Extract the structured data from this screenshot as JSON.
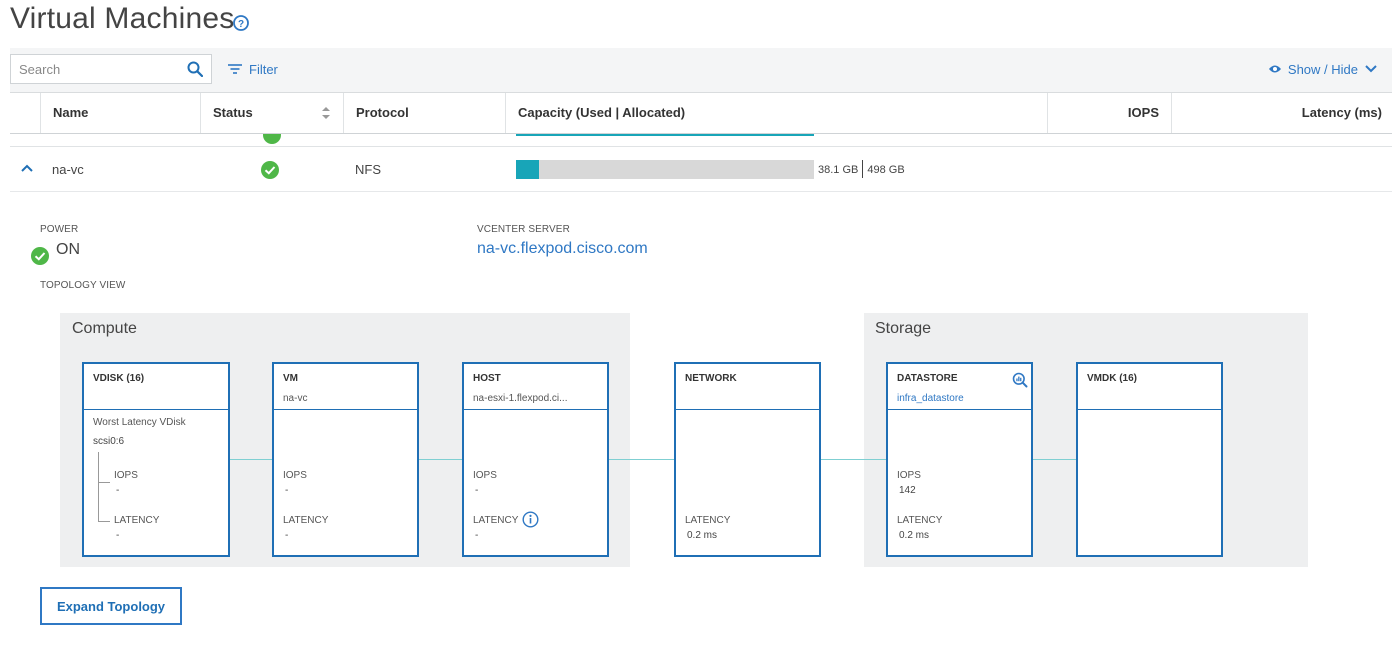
{
  "page": {
    "title": "Virtual Machines"
  },
  "toolbar": {
    "search_placeholder": "Search",
    "filter_label": "Filter",
    "show_hide_label": "Show / Hide"
  },
  "table": {
    "columns": [
      "Name",
      "Status",
      "Protocol",
      "Capacity (Used | Allocated)",
      "IOPS",
      "Latency (ms)"
    ],
    "row": {
      "name": "na-vc",
      "status": "ok",
      "protocol": "NFS",
      "capacity_used": "38.1 GB",
      "capacity_allocated": "498 GB",
      "capacity_fraction": 0.0765
    }
  },
  "details": {
    "power_label": "POWER",
    "power_value": "ON",
    "vcenter_label": "VCENTER SERVER",
    "vcenter_value": "na-vc.flexpod.cisco.com",
    "topology_label": "TOPOLOGY VIEW"
  },
  "topology": {
    "compute_title": "Compute",
    "storage_title": "Storage",
    "vdisk": {
      "title": "VDISK (16)",
      "worst_label": "Worst Latency VDisk",
      "worst_value": "scsi0:6",
      "iops_label": "IOPS",
      "iops_value": "-",
      "latency_label": "LATENCY",
      "latency_value": "-"
    },
    "vm": {
      "title": "VM",
      "subtitle": "na-vc",
      "iops_label": "IOPS",
      "iops_value": "-",
      "latency_label": "LATENCY",
      "latency_value": "-"
    },
    "host": {
      "title": "HOST",
      "subtitle": "na-esxi-1.flexpod.ci...",
      "iops_label": "IOPS",
      "iops_value": "-",
      "latency_label": "LATENCY",
      "latency_value": "-"
    },
    "network": {
      "title": "NETWORK",
      "latency_label": "LATENCY",
      "latency_value": "0.2 ms"
    },
    "datastore": {
      "title": "DATASTORE",
      "subtitle": "infra_datastore",
      "iops_label": "IOPS",
      "iops_value": "142",
      "latency_label": "LATENCY",
      "latency_value": "0.2 ms"
    },
    "vmdk": {
      "title": "VMDK (16)"
    }
  },
  "actions": {
    "expand_topology_label": "Expand Topology"
  },
  "colors": {
    "accent": "#2f78c4",
    "card_border": "#1f6fb5",
    "ok": "#4fb748",
    "capacity": "#18a5b8"
  }
}
